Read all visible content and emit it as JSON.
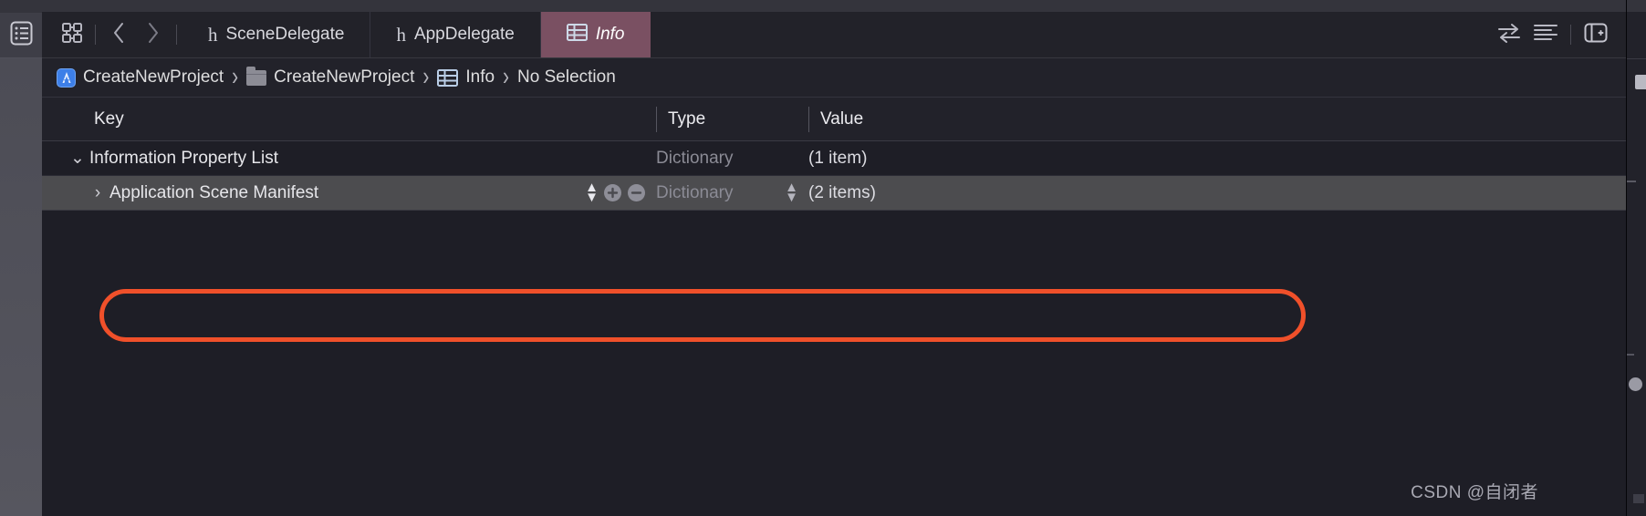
{
  "window": {
    "app": "Xcode",
    "theme_bg": "#1e1e26",
    "accent_tab": "#7a5062",
    "annotation_color": "#f0502a"
  },
  "left_gutter": {
    "icon": "document-list-icon",
    "tooltip": "Show Navigator"
  },
  "tabbar": {
    "left_tools": [
      {
        "name": "related-items-icon",
        "label": ""
      },
      {
        "name": "back-chevron-icon",
        "label": "‹"
      },
      {
        "name": "forward-chevron-icon",
        "label": "›"
      }
    ],
    "tabs": [
      {
        "id": "scene-delegate",
        "label": "SceneDelegate",
        "icon": "swift-header-file-icon",
        "icon_glyph": "h",
        "active": false
      },
      {
        "id": "app-delegate",
        "label": "AppDelegate",
        "icon": "swift-header-file-icon",
        "icon_glyph": "h",
        "active": false
      },
      {
        "id": "info",
        "label": "Info",
        "icon": "plist-table-icon",
        "active": true
      }
    ],
    "right_tools": [
      {
        "name": "compare-versions-icon"
      },
      {
        "name": "line-alignment-icon"
      },
      {
        "name": "add-editor-icon"
      }
    ]
  },
  "jumpbar": {
    "crumbs": [
      {
        "label": "CreateNewProject",
        "icon": "xcode-project-icon"
      },
      {
        "label": "CreateNewProject",
        "icon": "folder-icon"
      },
      {
        "label": "Info",
        "icon": "plist-table-icon"
      },
      {
        "label": "No Selection",
        "icon": null
      }
    ],
    "separator": "›"
  },
  "plist": {
    "columns": [
      {
        "id": "key",
        "label": "Key"
      },
      {
        "id": "type",
        "label": "Type"
      },
      {
        "id": "value",
        "label": "Value"
      }
    ],
    "rows": [
      {
        "id": "information-property-list",
        "key": "Information Property List",
        "type": "Dictionary",
        "value": "(1 item)",
        "depth": 0,
        "expanded": true,
        "disclosure": "⌄",
        "selected": false,
        "has_controls": false
      },
      {
        "id": "application-scene-manifest",
        "key": "Application Scene Manifest",
        "type": "Dictionary",
        "value": "(2 items)",
        "depth": 1,
        "expanded": false,
        "disclosure": "›",
        "selected": true,
        "has_controls": true,
        "controls": {
          "reorder_stepper": "reorder-stepper",
          "add_button": "add-row-button",
          "remove_button": "remove-row-button",
          "type_stepper": "type-select-stepper"
        }
      }
    ]
  },
  "annotation": {
    "shape": "oval",
    "target_row": "Application Scene Manifest",
    "color": "#f0502a"
  },
  "watermark": {
    "text": "CSDN @自闭者"
  }
}
